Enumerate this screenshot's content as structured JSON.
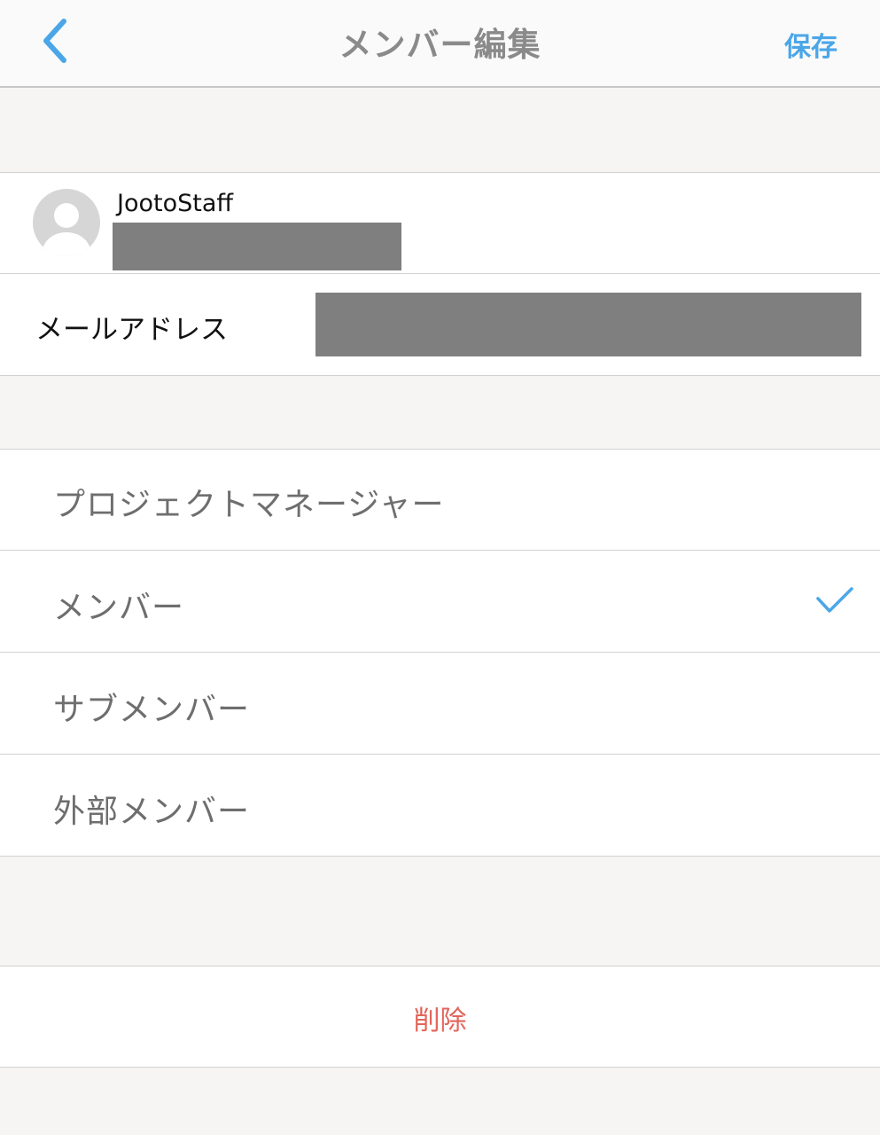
{
  "nav": {
    "back_icon": "chevron-left-icon",
    "title": "メンバー編集",
    "save_label": "保存",
    "accent_color": "#4ba6e8"
  },
  "profile": {
    "name": "JootoStaff",
    "avatar_icon": "default-avatar-icon"
  },
  "email": {
    "label": "メールアドレス"
  },
  "roles": {
    "items": [
      {
        "label": "プロジェクトマネージャー",
        "selected": false
      },
      {
        "label": "メンバー",
        "selected": true
      },
      {
        "label": "サブメンバー",
        "selected": false
      },
      {
        "label": "外部メンバー",
        "selected": false
      }
    ],
    "check_icon": "checkmark-icon"
  },
  "actions": {
    "delete_label": "削除",
    "delete_color": "#e2655a"
  }
}
